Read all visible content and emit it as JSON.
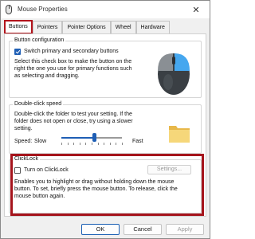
{
  "window": {
    "title": "Mouse Properties",
    "close_glyph": "✕"
  },
  "tabs": [
    {
      "label": "Buttons",
      "active": true
    },
    {
      "label": "Pointers",
      "active": false
    },
    {
      "label": "Pointer Options",
      "active": false
    },
    {
      "label": "Wheel",
      "active": false
    },
    {
      "label": "Hardware",
      "active": false
    }
  ],
  "button_config": {
    "title": "Button configuration",
    "checkbox_label": "Switch primary and secondary buttons",
    "checked": true,
    "description_lines": [
      "Select this check box to make the button on the",
      "right the one you use for primary functions such",
      "as selecting and dragging."
    ]
  },
  "double_click": {
    "title": "Double-click speed",
    "description_lines": [
      "Double-click the folder to test your setting. If the",
      "folder does not open or close, try using a slower",
      "setting."
    ],
    "speed_label": "Speed:",
    "slow_label": "Slow",
    "fast_label": "Fast",
    "speed_level": 0.55
  },
  "clicklock": {
    "title": "ClickLock",
    "checkbox_label": "Turn on ClickLock",
    "checked": false,
    "settings_label": "Settings...",
    "description_lines": [
      "Enables you to highlight or drag without holding down the mouse",
      "button. To set, briefly press the mouse button. To release, click the",
      "mouse button again."
    ]
  },
  "buttons": {
    "ok": "OK",
    "cancel": "Cancel",
    "apply": "Apply"
  },
  "colors": {
    "accent": "#1f5fb5",
    "highlight": "#a5141c",
    "mouse_body": "#3a3f44",
    "mouse_button": "#45a7ef",
    "folder": "#f6d77a"
  }
}
